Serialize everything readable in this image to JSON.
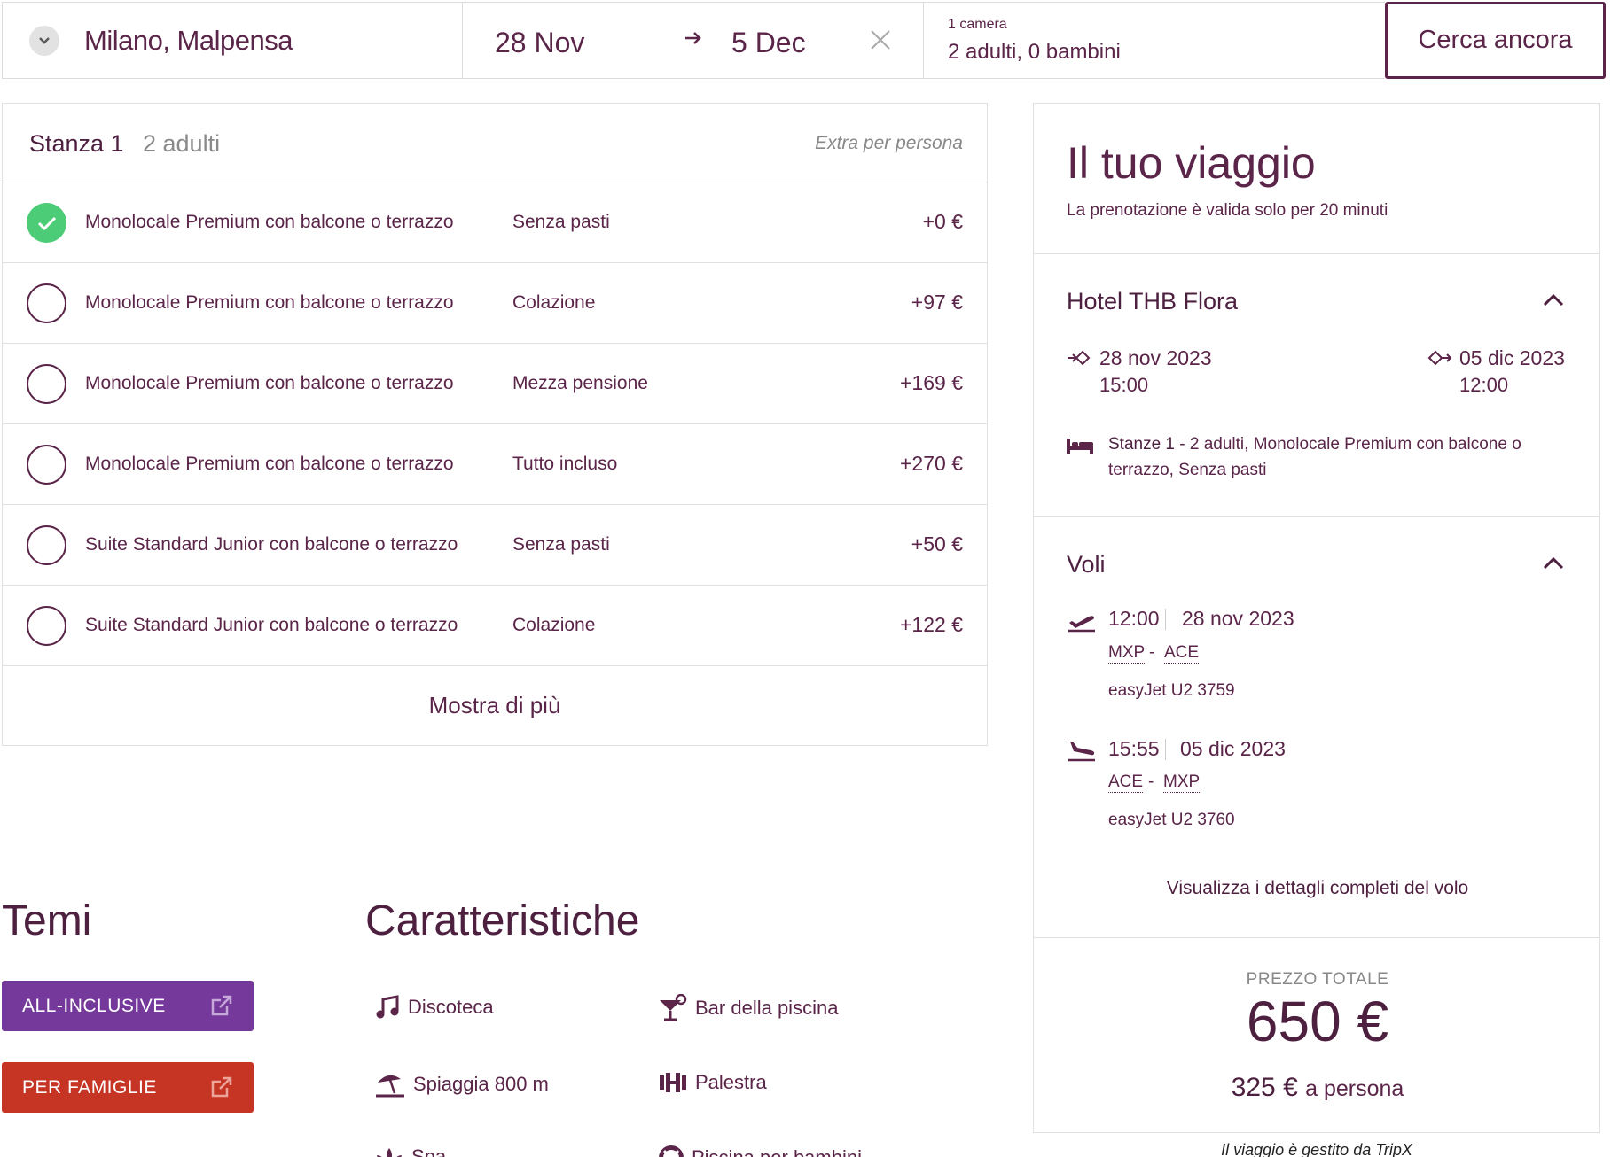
{
  "search": {
    "origin": "Milano, Malpensa",
    "date_from": "28 Nov",
    "date_to": "5 Dec",
    "rooms": "1 camera",
    "guests": "2 adulti, 0 bambini",
    "button": "Cerca ancora"
  },
  "room_panel": {
    "title": "Stanza 1",
    "subtitle": "2 adulti",
    "extra_header": "Extra per persona",
    "options": [
      {
        "name": "Monolocale Premium con balcone o terrazzo",
        "board": "Senza pasti",
        "price": "+0 €",
        "selected": true
      },
      {
        "name": "Monolocale Premium con balcone o terrazzo",
        "board": "Colazione",
        "price": "+97 €",
        "selected": false
      },
      {
        "name": "Monolocale Premium con balcone o terrazzo",
        "board": "Mezza pensione",
        "price": "+169 €",
        "selected": false
      },
      {
        "name": "Monolocale Premium con balcone o terrazzo",
        "board": "Tutto incluso",
        "price": "+270 €",
        "selected": false
      },
      {
        "name": "Suite Standard Junior con balcone o terrazzo",
        "board": "Senza pasti",
        "price": "+50 €",
        "selected": false
      },
      {
        "name": "Suite Standard Junior con balcone o terrazzo",
        "board": "Colazione",
        "price": "+122 €",
        "selected": false
      }
    ],
    "show_more": "Mostra di più"
  },
  "themes": {
    "title": "Temi",
    "items": [
      {
        "label": "ALL-INCLUSIVE",
        "color": "#74399a"
      },
      {
        "label": "PER FAMIGLIE",
        "color": "#c63424"
      }
    ]
  },
  "features": {
    "title": "Caratteristiche",
    "items": [
      {
        "label": "Discoteca",
        "icon": "music-note-icon"
      },
      {
        "label": "Bar della piscina",
        "icon": "cocktail-icon"
      },
      {
        "label": "Spiaggia 800 m",
        "icon": "beach-umbrella-icon"
      },
      {
        "label": "Palestra",
        "icon": "dumbbell-icon"
      },
      {
        "label": "Spa",
        "icon": "lotus-icon"
      },
      {
        "label": "Piscina per bambini",
        "icon": "lifebuoy-icon"
      }
    ]
  },
  "trip": {
    "title": "Il tuo viaggio",
    "note": "La prenotazione è valida solo per 20 minuti",
    "hotel": {
      "name": "Hotel THB Flora",
      "checkin_date": "28 nov 2023",
      "checkin_time": "15:00",
      "checkout_date": "05 dic 2023",
      "checkout_time": "12:00",
      "rooms_label": "Stanze 1",
      "rooms_detail": "- 2 adulti, Monolocale Premium con balcone o terrazzo, Senza pasti"
    },
    "flights": {
      "title": "Voli",
      "outbound": {
        "time": "12:00",
        "date": "28 nov 2023",
        "from": "MXP",
        "to": "ACE",
        "carrier": "easyJet U2 3759"
      },
      "inbound": {
        "time": "15:55",
        "date": "05 dic 2023",
        "from": "ACE",
        "to": "MXP",
        "carrier": "easyJet U2 3760"
      },
      "details_link": "Visualizza i dettagli completi del volo"
    },
    "price": {
      "label": "PREZZO TOTALE",
      "total": "650 €",
      "per_person": "325 €",
      "per_person_suffix": "a persona"
    },
    "footer": "Il viaggio è gestito da TripX"
  },
  "colors": {
    "brand": "#5a2548",
    "selected": "#4dcc78"
  }
}
